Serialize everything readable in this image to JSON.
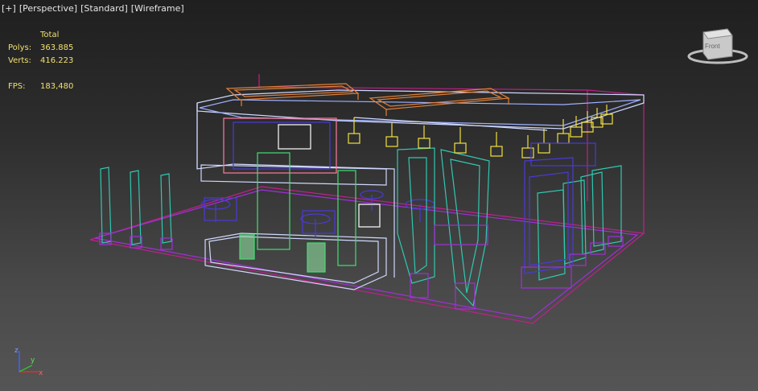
{
  "viewport_menu": {
    "plus": "[+]",
    "perspective": "[Perspective]",
    "standard": "[Standard]",
    "wireframe": "[Wireframe]"
  },
  "stats": {
    "header": "Total",
    "polys_label": "Polys:",
    "polys_value": "363.885",
    "verts_label": "Verts:",
    "verts_value": "416.223",
    "fps_label": "FPS:",
    "fps_value": "183,480"
  },
  "viewcube": {
    "face_label": "Front"
  },
  "axis": {
    "z": "z",
    "y": "y",
    "x": "x"
  },
  "colors": {
    "wire_white": "#cfd8ff",
    "wire_magenta": "#c0208a",
    "wire_cyan": "#30c8b0",
    "wire_blue": "#4a3ad8",
    "wire_orange": "#e0803a",
    "wire_yellow": "#f0e040",
    "wire_purple": "#a030d8",
    "wire_green": "#40e070",
    "wire_pink": "#ff7aa0",
    "stats_text": "#f0e070"
  },
  "wire_objects": [
    "floor",
    "back-frame",
    "ceiling-beams",
    "hanging-lights",
    "counter",
    "pillars",
    "tables-chairs",
    "door-frames",
    "panels"
  ]
}
